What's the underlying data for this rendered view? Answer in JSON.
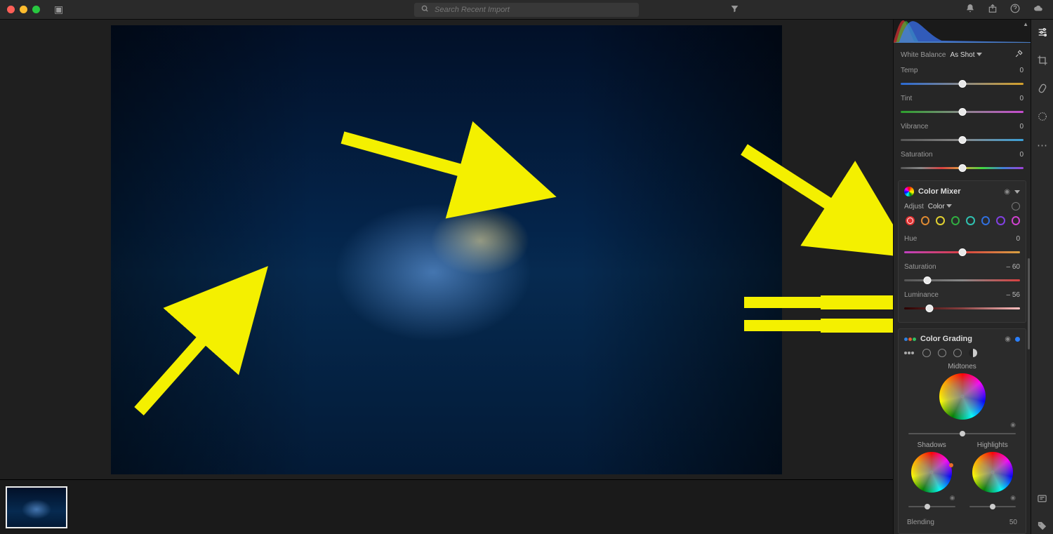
{
  "search": {
    "placeholder": "Search Recent Import"
  },
  "whiteBalance": {
    "label": "White Balance",
    "mode": "As Shot",
    "temp": {
      "label": "Temp",
      "value": "0",
      "pos": 50
    },
    "tint": {
      "label": "Tint",
      "value": "0",
      "pos": 50
    },
    "vibrance": {
      "label": "Vibrance",
      "value": "0",
      "pos": 50
    },
    "saturation": {
      "label": "Saturation",
      "value": "0",
      "pos": 50
    }
  },
  "colorMixer": {
    "title": "Color Mixer",
    "adjustLabel": "Adjust",
    "adjustMode": "Color",
    "colors": [
      "#e03030",
      "#e08a30",
      "#e0d030",
      "#30b040",
      "#30c0b0",
      "#3070e0",
      "#8040e0",
      "#d040d0"
    ],
    "activeColorIndex": 0,
    "hue": {
      "label": "Hue",
      "value": "0",
      "pos": 50
    },
    "saturation": {
      "label": "Saturation",
      "value": "– 60",
      "pos": 20
    },
    "luminance": {
      "label": "Luminance",
      "value": "– 56",
      "pos": 22
    }
  },
  "colorGrading": {
    "title": "Color Grading",
    "midtones": "Midtones",
    "shadows": "Shadows",
    "highlights": "Highlights",
    "blending": {
      "label": "Blending",
      "value": "50"
    }
  }
}
